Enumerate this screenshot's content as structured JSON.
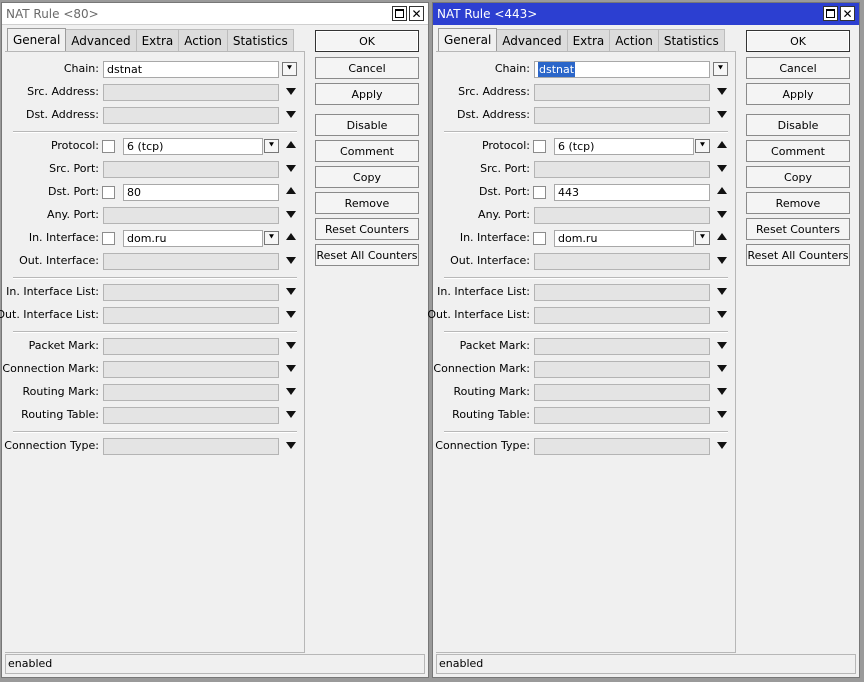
{
  "windows": [
    {
      "title": "NAT Rule <80>",
      "tabs": [
        "General",
        "Advanced",
        "Extra",
        "Action",
        "Statistics"
      ],
      "active_tab": "General",
      "fields": {
        "chain": {
          "label": "Chain:",
          "value": "dstnat"
        },
        "src_address": {
          "label": "Src. Address:",
          "value": ""
        },
        "dst_address": {
          "label": "Dst. Address:",
          "value": ""
        },
        "protocol": {
          "label": "Protocol:",
          "value": "6 (tcp)"
        },
        "src_port": {
          "label": "Src. Port:",
          "value": ""
        },
        "dst_port": {
          "label": "Dst. Port:",
          "value": "80"
        },
        "any_port": {
          "label": "Any. Port:",
          "value": ""
        },
        "in_interface": {
          "label": "In. Interface:",
          "value": "dom.ru"
        },
        "out_interface": {
          "label": "Out. Interface:",
          "value": ""
        },
        "in_interface_list": {
          "label": "In. Interface List:",
          "value": ""
        },
        "out_interface_list": {
          "label": "Out. Interface List:",
          "value": ""
        },
        "packet_mark": {
          "label": "Packet Mark:",
          "value": ""
        },
        "connection_mark": {
          "label": "Connection Mark:",
          "value": ""
        },
        "routing_mark": {
          "label": "Routing Mark:",
          "value": ""
        },
        "routing_table": {
          "label": "Routing Table:",
          "value": ""
        },
        "connection_type": {
          "label": "Connection Type:",
          "value": ""
        }
      },
      "buttons": [
        "OK",
        "Cancel",
        "Apply",
        "Disable",
        "Comment",
        "Copy",
        "Remove",
        "Reset Counters",
        "Reset All Counters"
      ],
      "status": "enabled"
    },
    {
      "title": "NAT Rule <443>",
      "tabs": [
        "General",
        "Advanced",
        "Extra",
        "Action",
        "Statistics"
      ],
      "active_tab": "General",
      "fields": {
        "chain": {
          "label": "Chain:",
          "value": "dstnat"
        },
        "src_address": {
          "label": "Src. Address:",
          "value": ""
        },
        "dst_address": {
          "label": "Dst. Address:",
          "value": ""
        },
        "protocol": {
          "label": "Protocol:",
          "value": "6 (tcp)"
        },
        "src_port": {
          "label": "Src. Port:",
          "value": ""
        },
        "dst_port": {
          "label": "Dst. Port:",
          "value": "443"
        },
        "any_port": {
          "label": "Any. Port:",
          "value": ""
        },
        "in_interface": {
          "label": "In. Interface:",
          "value": "dom.ru"
        },
        "out_interface": {
          "label": "Out. Interface:",
          "value": ""
        },
        "in_interface_list": {
          "label": "In. Interface List:",
          "value": ""
        },
        "out_interface_list": {
          "label": "Out. Interface List:",
          "value": ""
        },
        "packet_mark": {
          "label": "Packet Mark:",
          "value": ""
        },
        "connection_mark": {
          "label": "Connection Mark:",
          "value": ""
        },
        "routing_mark": {
          "label": "Routing Mark:",
          "value": ""
        },
        "routing_table": {
          "label": "Routing Table:",
          "value": ""
        },
        "connection_type": {
          "label": "Connection Type:",
          "value": ""
        }
      },
      "buttons": [
        "OK",
        "Cancel",
        "Apply",
        "Disable",
        "Comment",
        "Copy",
        "Remove",
        "Reset Counters",
        "Reset All Counters"
      ],
      "status": "enabled"
    }
  ],
  "colors": {
    "active_titlebar": "#2c3fd1",
    "inactive_titlebar": "#ffffff",
    "selection": "#2b66c9",
    "window_bg": "#f0f0f0",
    "desktop_bg": "#9a9a9a"
  }
}
